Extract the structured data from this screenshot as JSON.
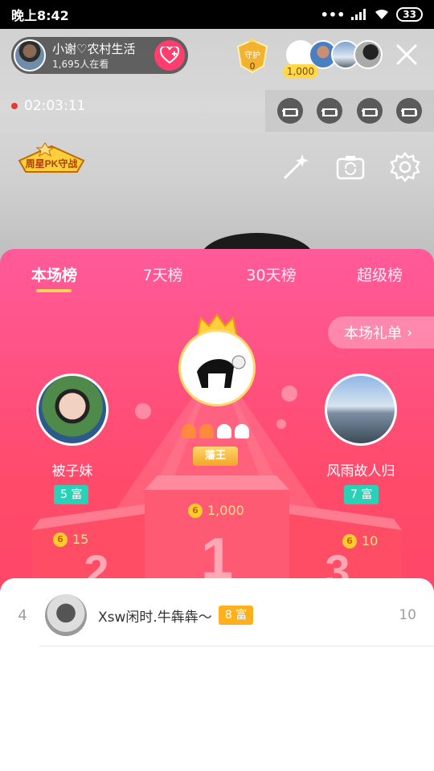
{
  "status_bar": {
    "time": "晚上8:42",
    "battery": "33"
  },
  "host": {
    "name": "小谢♡农村生活",
    "viewers": "1,695人在看"
  },
  "guard": {
    "label": "守护",
    "count": "0"
  },
  "top_viewer_coins": "1,000",
  "live_timer": "02:03:11",
  "weekly_badge_text": "周星PK守战",
  "tabs": [
    "本场榜",
    "7天榜",
    "30天榜",
    "超级榜"
  ],
  "gift_list_label": "本场礼单",
  "ranking": {
    "first": {
      "title": "藩王",
      "coins": "1,000"
    },
    "second": {
      "name": "被子妹",
      "rich_level": "5 富",
      "coins": "15"
    },
    "third": {
      "name": "风雨故人归",
      "rich_level": "7 富",
      "coins": "10"
    }
  },
  "list": [
    {
      "rank": "4",
      "name": "Xsw闲时.牛犇犇～",
      "rich_level": "8 富",
      "value": "10"
    }
  ],
  "colors": {
    "panel_top": "#ff5a9a",
    "panel_bottom": "#ff4466",
    "accent_gold": "#ffd25c",
    "teal": "#2ad1b6"
  }
}
